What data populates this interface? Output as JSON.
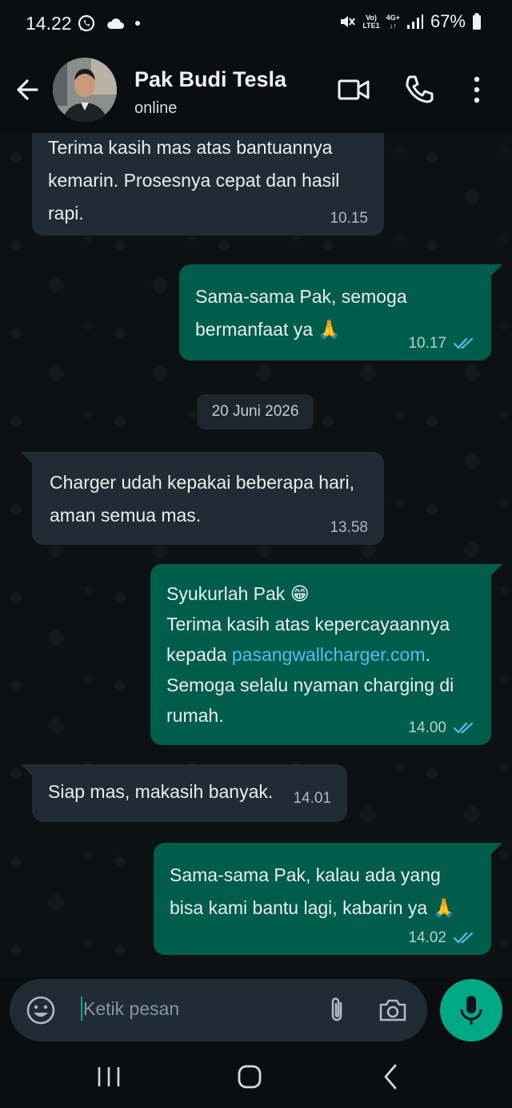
{
  "status_bar": {
    "time": "14.22",
    "network_top": "Vo)",
    "network_bottom": "LTE1",
    "network_type": "4G+",
    "battery": "67%"
  },
  "header": {
    "contact_name": "Pak Budi Tesla",
    "contact_status": "online",
    "icons": [
      "back-arrow-icon",
      "video-call-icon",
      "phone-icon",
      "more-options-icon"
    ]
  },
  "messages": [
    {
      "direction": "in",
      "text": "Terima kasih mas atas bantuannya\nkemarin. Prosesnya cepat dan hasil\nrapi.",
      "time": "10.15"
    },
    {
      "direction": "out",
      "text": "Sama-sama Pak, semoga\nbermanfaat ya 🙏",
      "time": "10.17",
      "read": true
    },
    {
      "direction": "in",
      "text": "Charger udah kepakai beberapa hari,\naman semua mas.",
      "time": "13.58"
    },
    {
      "direction": "out",
      "text_before_link": "Syukurlah Pak 😁\nTerima kasih atas kepercayaannya\nkepada ",
      "link": "pasangwallcharger.com",
      "text_after_link": ".\nSemoga selalu nyaman charging di\nrumah.",
      "time": "14.00",
      "read": true
    },
    {
      "direction": "in",
      "text": "Siap mas, makasih banyak.",
      "time": "14.01"
    },
    {
      "direction": "out",
      "text": "Sama-sama Pak, kalau ada yang\nbisa kami bantu lagi, kabarin ya 🙏",
      "time": "14.02",
      "read": true
    }
  ],
  "date_separator": "20 Juni 2026",
  "input": {
    "placeholder": "Ketik pesan"
  },
  "colors": {
    "incoming_bubble": "#202c33",
    "outgoing_bubble": "#005c4b",
    "accent": "#00a884",
    "link": "#53bdeb",
    "read_ticks": "#53bdeb"
  }
}
